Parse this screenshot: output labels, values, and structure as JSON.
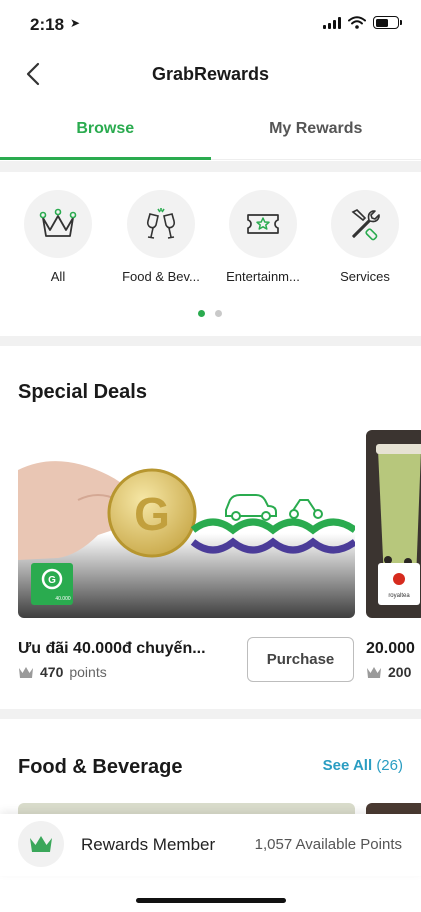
{
  "status_bar": {
    "time": "2:18"
  },
  "nav": {
    "title": "GrabRewards"
  },
  "tabs": [
    {
      "label": "Browse",
      "active": true
    },
    {
      "label": "My Rewards",
      "active": false
    }
  ],
  "categories": [
    {
      "label": "All",
      "icon": "crown-icon"
    },
    {
      "label": "Food & Bev...",
      "icon": "wine-glasses-icon"
    },
    {
      "label": "Entertainm...",
      "icon": "ticket-icon"
    },
    {
      "label": "Services",
      "icon": "tools-icon"
    }
  ],
  "carousel": {
    "pages": 2,
    "current": 1
  },
  "special_deals": {
    "title": "Special Deals",
    "deals": [
      {
        "title": "Ưu đãi 40.000đ chuyến...",
        "points": "470",
        "points_unit": "points",
        "button": "Purchase",
        "badge_text": "40.000"
      },
      {
        "title": "20.000",
        "points": "200",
        "badge_text": "royaltea"
      }
    ]
  },
  "food_beverage": {
    "title": "Food & Beverage",
    "see_all": "See All",
    "count": "(26)"
  },
  "member_bar": {
    "label": "Rewards Member",
    "points": "1,057 Available Points"
  },
  "colors": {
    "accent": "#2aab4f",
    "link": "#2a9dc2",
    "section_gap": "#f1f1f1"
  }
}
